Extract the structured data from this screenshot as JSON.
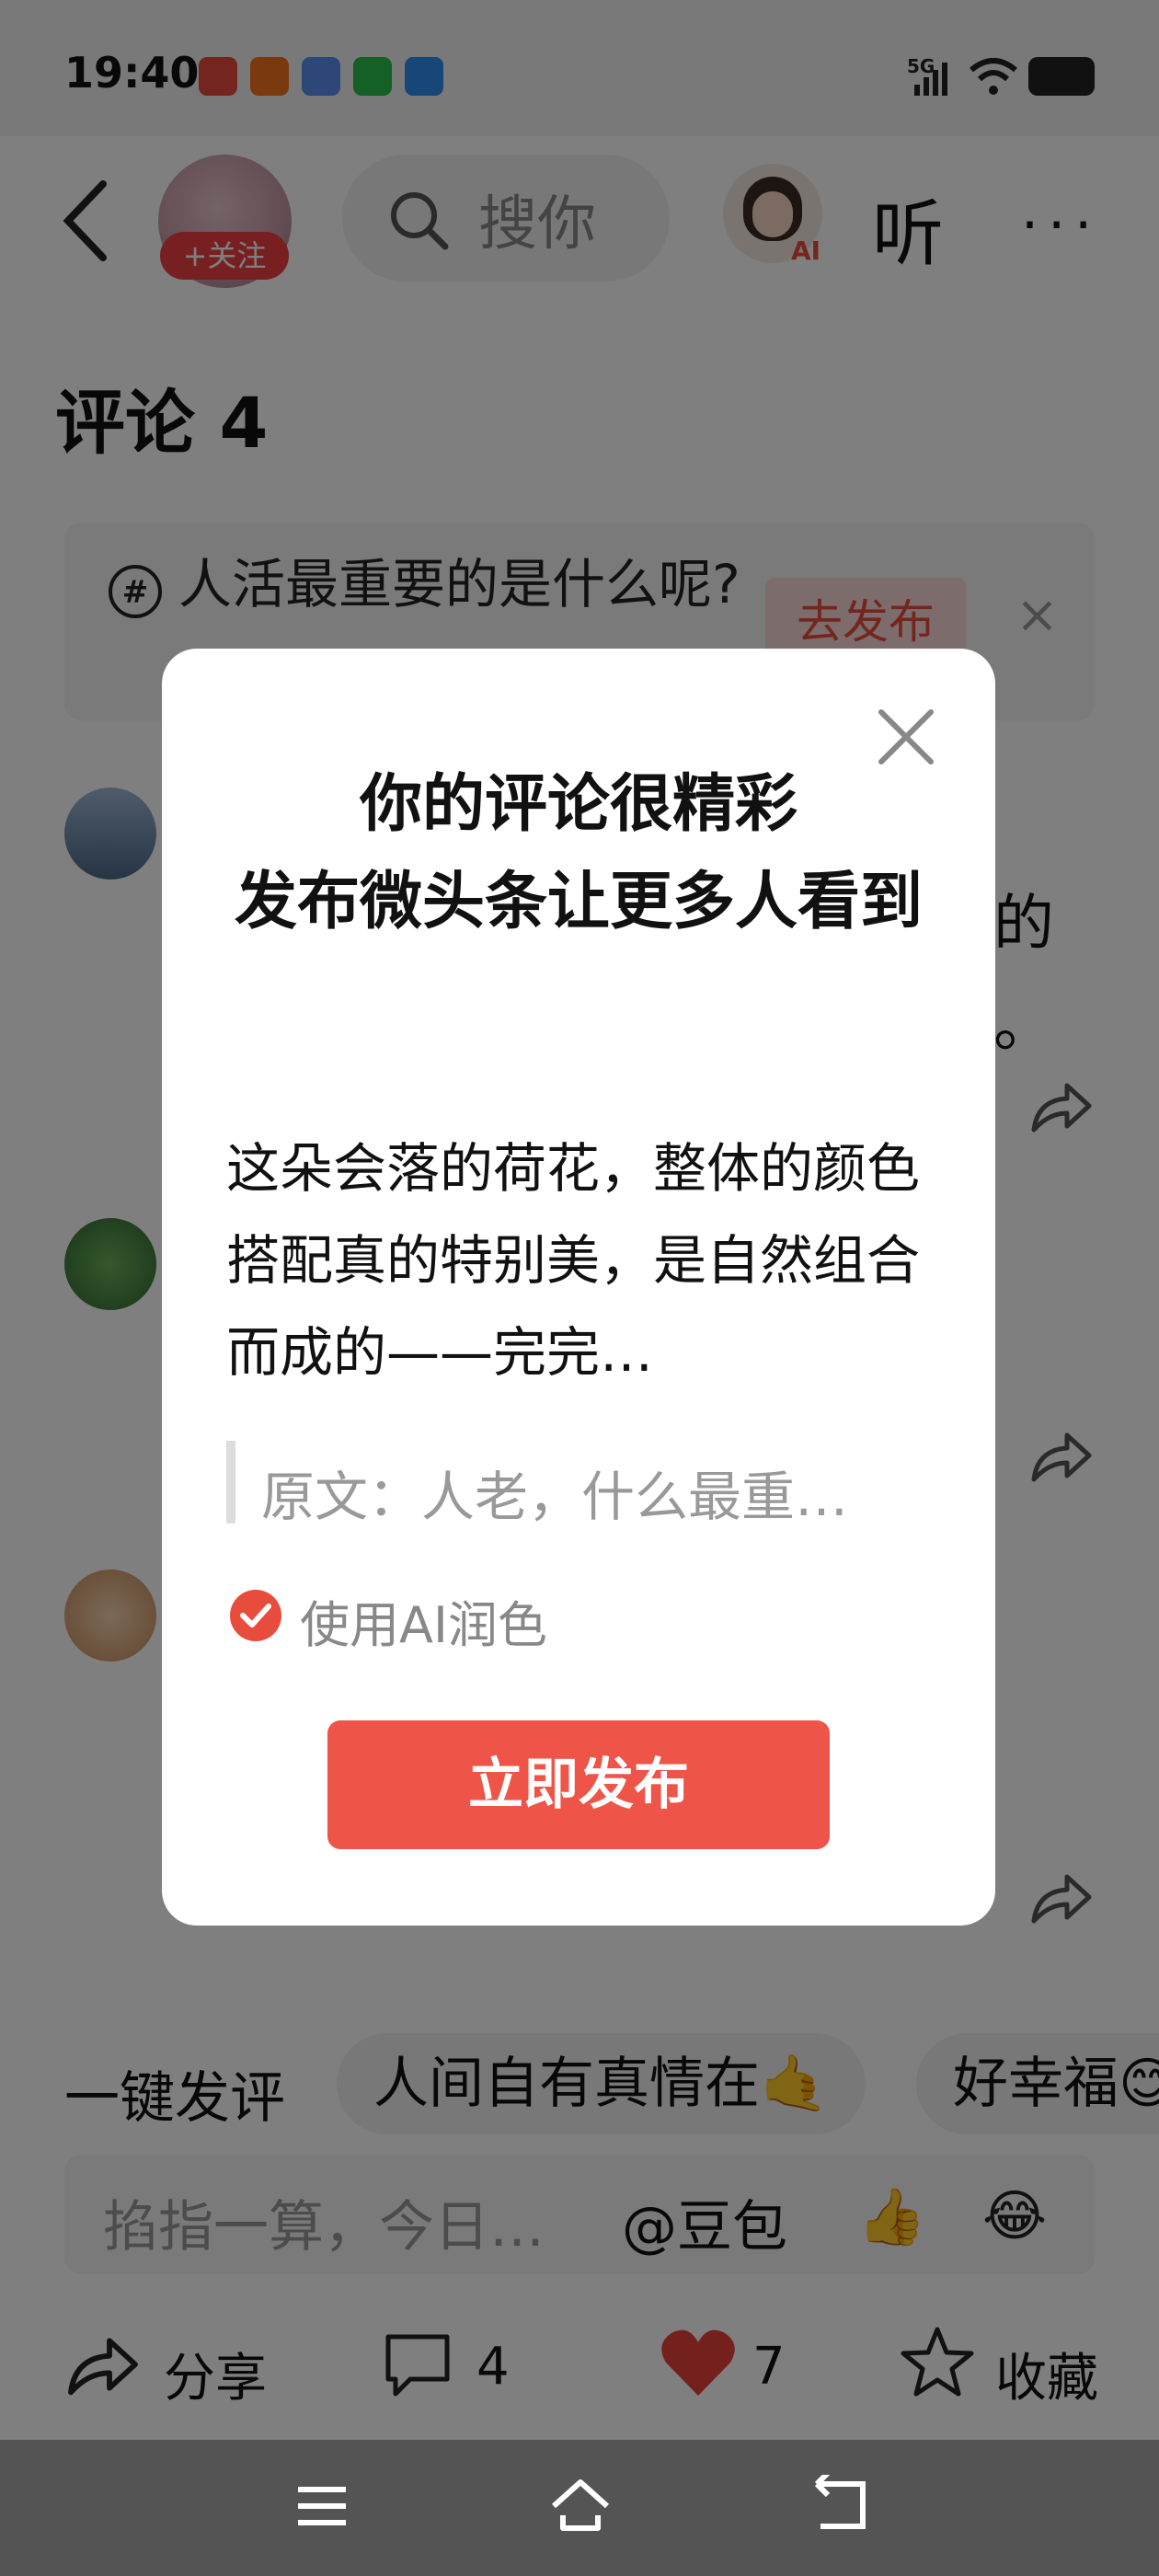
{
  "status_bar": {
    "time": "19:40",
    "network": "5G"
  },
  "header": {
    "follow_label": "+关注",
    "search_placeholder": "搜你",
    "ai_badge": "AI",
    "listen_label": "听",
    "more_label": "···"
  },
  "comments": {
    "title": "评论 4"
  },
  "topic": {
    "text": "人活最重要的是什么呢?",
    "publish_label": "去发布",
    "close_label": "×"
  },
  "background_fragments": {
    "frag1": "的",
    "frag2": "。"
  },
  "quick_reply": {
    "label": "一键发评",
    "chips": [
      "人间自有真情在🤙",
      "好幸福😊"
    ]
  },
  "input": {
    "placeholder": "掐指一算，今日…",
    "doubao": "@豆包"
  },
  "actions": {
    "share": "分享",
    "comments": "4",
    "likes": "7",
    "favorite": "收藏"
  },
  "dialog": {
    "title": "你的评论很精彩\n发布微头条让更多人看到",
    "body": "这朵会落的荷花，整体的颜色搭配真的特别美，是自然组合而成的——完完…",
    "quote": "原文：人老，什么最重…",
    "ai_polish_label": "使用AI润色",
    "ai_polish_checked": true,
    "publish_button": "立即发布"
  },
  "colors": {
    "brand_red": "#f04142",
    "button_red": "#ee5447"
  }
}
